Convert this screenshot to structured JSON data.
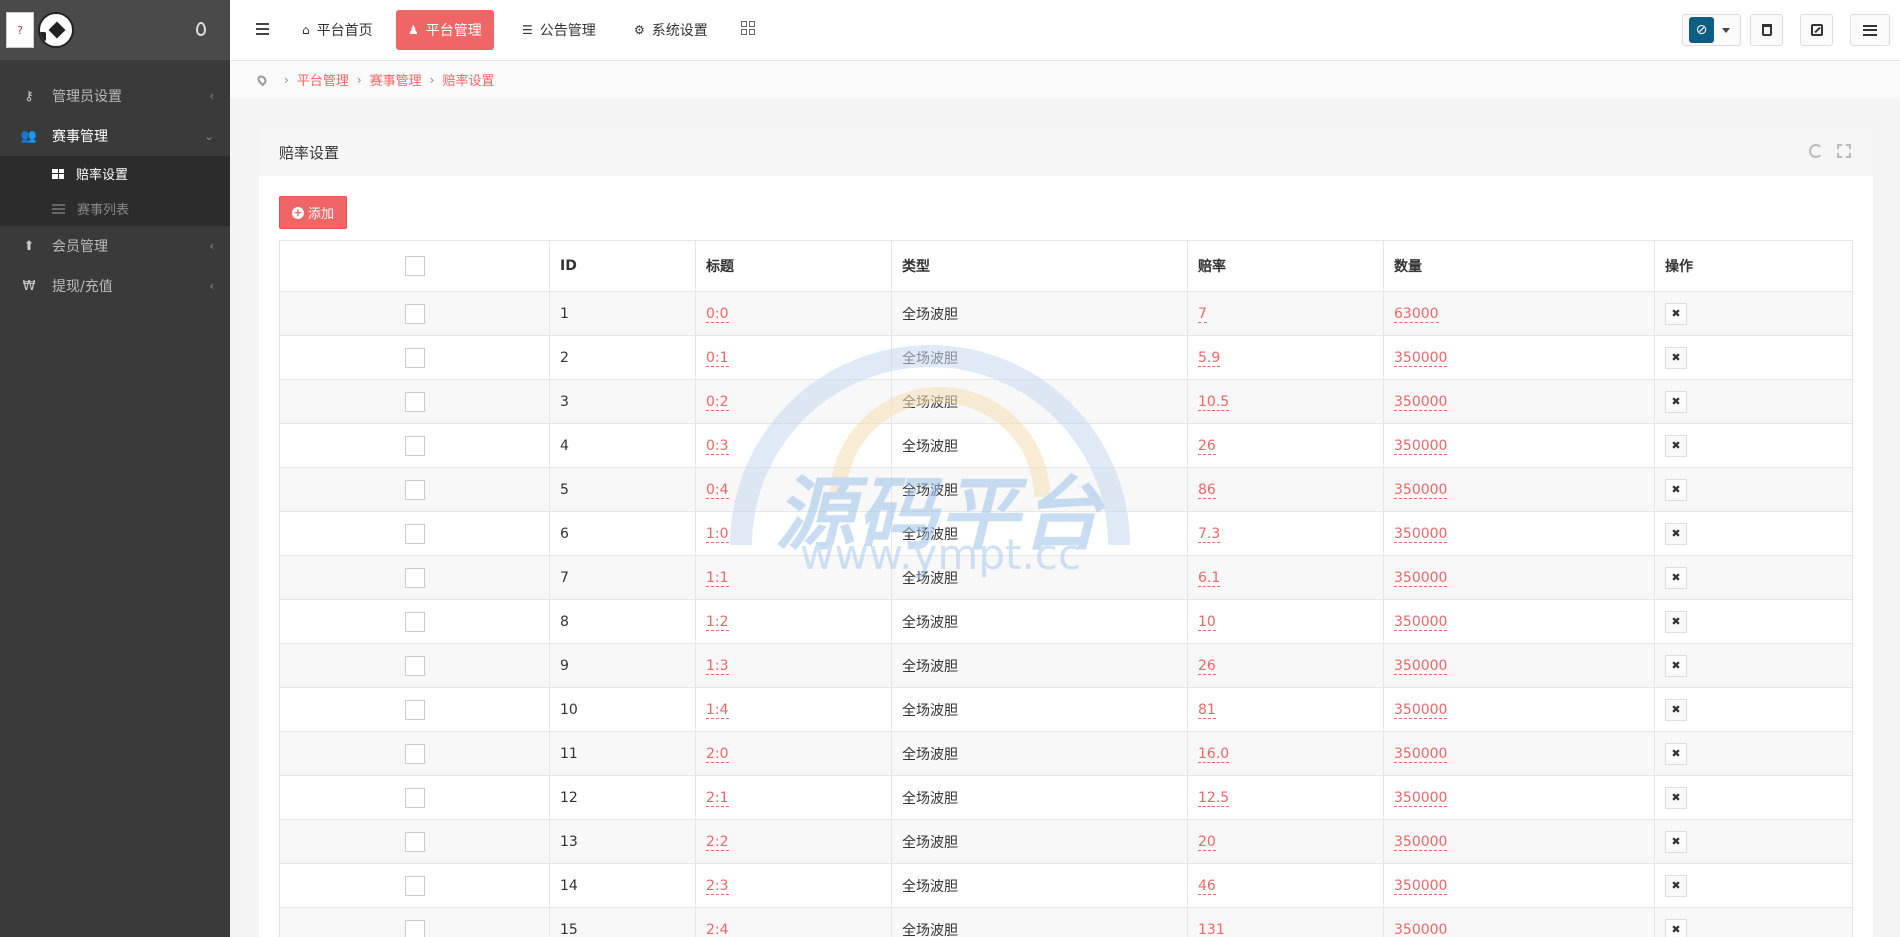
{
  "sidebar": {
    "items": [
      {
        "label": "管理员设置"
      },
      {
        "label": "赛事管理"
      },
      {
        "label": "会员管理"
      },
      {
        "label": "提现/充值"
      }
    ],
    "sub": [
      {
        "label": "赔率设置"
      },
      {
        "label": "赛事列表"
      }
    ]
  },
  "nav": {
    "home": "平台首页",
    "platform": "平台管理",
    "notice": "公告管理",
    "settings": "系统设置"
  },
  "breadcrumb": [
    "平台管理",
    "赛事管理",
    "赔率设置"
  ],
  "panel": {
    "title": "赔率设置",
    "add_label": "添加"
  },
  "table": {
    "headers": {
      "id": "ID",
      "title": "标题",
      "type": "类型",
      "odds": "赔率",
      "qty": "数量",
      "ops": "操作"
    },
    "rows": [
      {
        "id": "1",
        "title": "0:0",
        "type": "全场波胆",
        "odds": "7",
        "qty": "63000"
      },
      {
        "id": "2",
        "title": "0:1",
        "type": "全场波胆",
        "odds": "5.9",
        "qty": "350000"
      },
      {
        "id": "3",
        "title": "0:2",
        "type": "全场波胆",
        "odds": "10.5",
        "qty": "350000"
      },
      {
        "id": "4",
        "title": "0:3",
        "type": "全场波胆",
        "odds": "26",
        "qty": "350000"
      },
      {
        "id": "5",
        "title": "0:4",
        "type": "全场波胆",
        "odds": "86",
        "qty": "350000"
      },
      {
        "id": "6",
        "title": "1:0",
        "type": "全场波胆",
        "odds": "7.3",
        "qty": "350000"
      },
      {
        "id": "7",
        "title": "1:1",
        "type": "全场波胆",
        "odds": "6.1",
        "qty": "350000"
      },
      {
        "id": "8",
        "title": "1:2",
        "type": "全场波胆",
        "odds": "10",
        "qty": "350000"
      },
      {
        "id": "9",
        "title": "1:3",
        "type": "全场波胆",
        "odds": "26",
        "qty": "350000"
      },
      {
        "id": "10",
        "title": "1:4",
        "type": "全场波胆",
        "odds": "81",
        "qty": "350000"
      },
      {
        "id": "11",
        "title": "2:0",
        "type": "全场波胆",
        "odds": "16.0",
        "qty": "350000"
      },
      {
        "id": "12",
        "title": "2:1",
        "type": "全场波胆",
        "odds": "12.5",
        "qty": "350000"
      },
      {
        "id": "13",
        "title": "2:2",
        "type": "全场波胆",
        "odds": "20",
        "qty": "350000"
      },
      {
        "id": "14",
        "title": "2:3",
        "type": "全场波胆",
        "odds": "46",
        "qty": "350000"
      },
      {
        "id": "15",
        "title": "2:4",
        "type": "全场波胆",
        "odds": "131",
        "qty": "350000"
      }
    ]
  },
  "watermark": {
    "text": "源码平台",
    "url": "www.ympt.cc"
  },
  "colors": {
    "accent": "#f06666",
    "sidebar": "#3a3a3a",
    "avatar": "#0e5d84"
  },
  "icons": [
    "drop-icon",
    "key-icon",
    "users-icon",
    "dashboard-icon",
    "list-icon",
    "arrow-up-icon",
    "won-icon",
    "hamburger-icon",
    "home-icon",
    "user-icon",
    "list-alt-icon",
    "gear-icon",
    "grid-icon",
    "trash-icon",
    "external-link-icon",
    "menu-lines-icon",
    "map-pin-icon",
    "refresh-icon",
    "expand-icon",
    "plus-circle-icon",
    "close-icon"
  ]
}
